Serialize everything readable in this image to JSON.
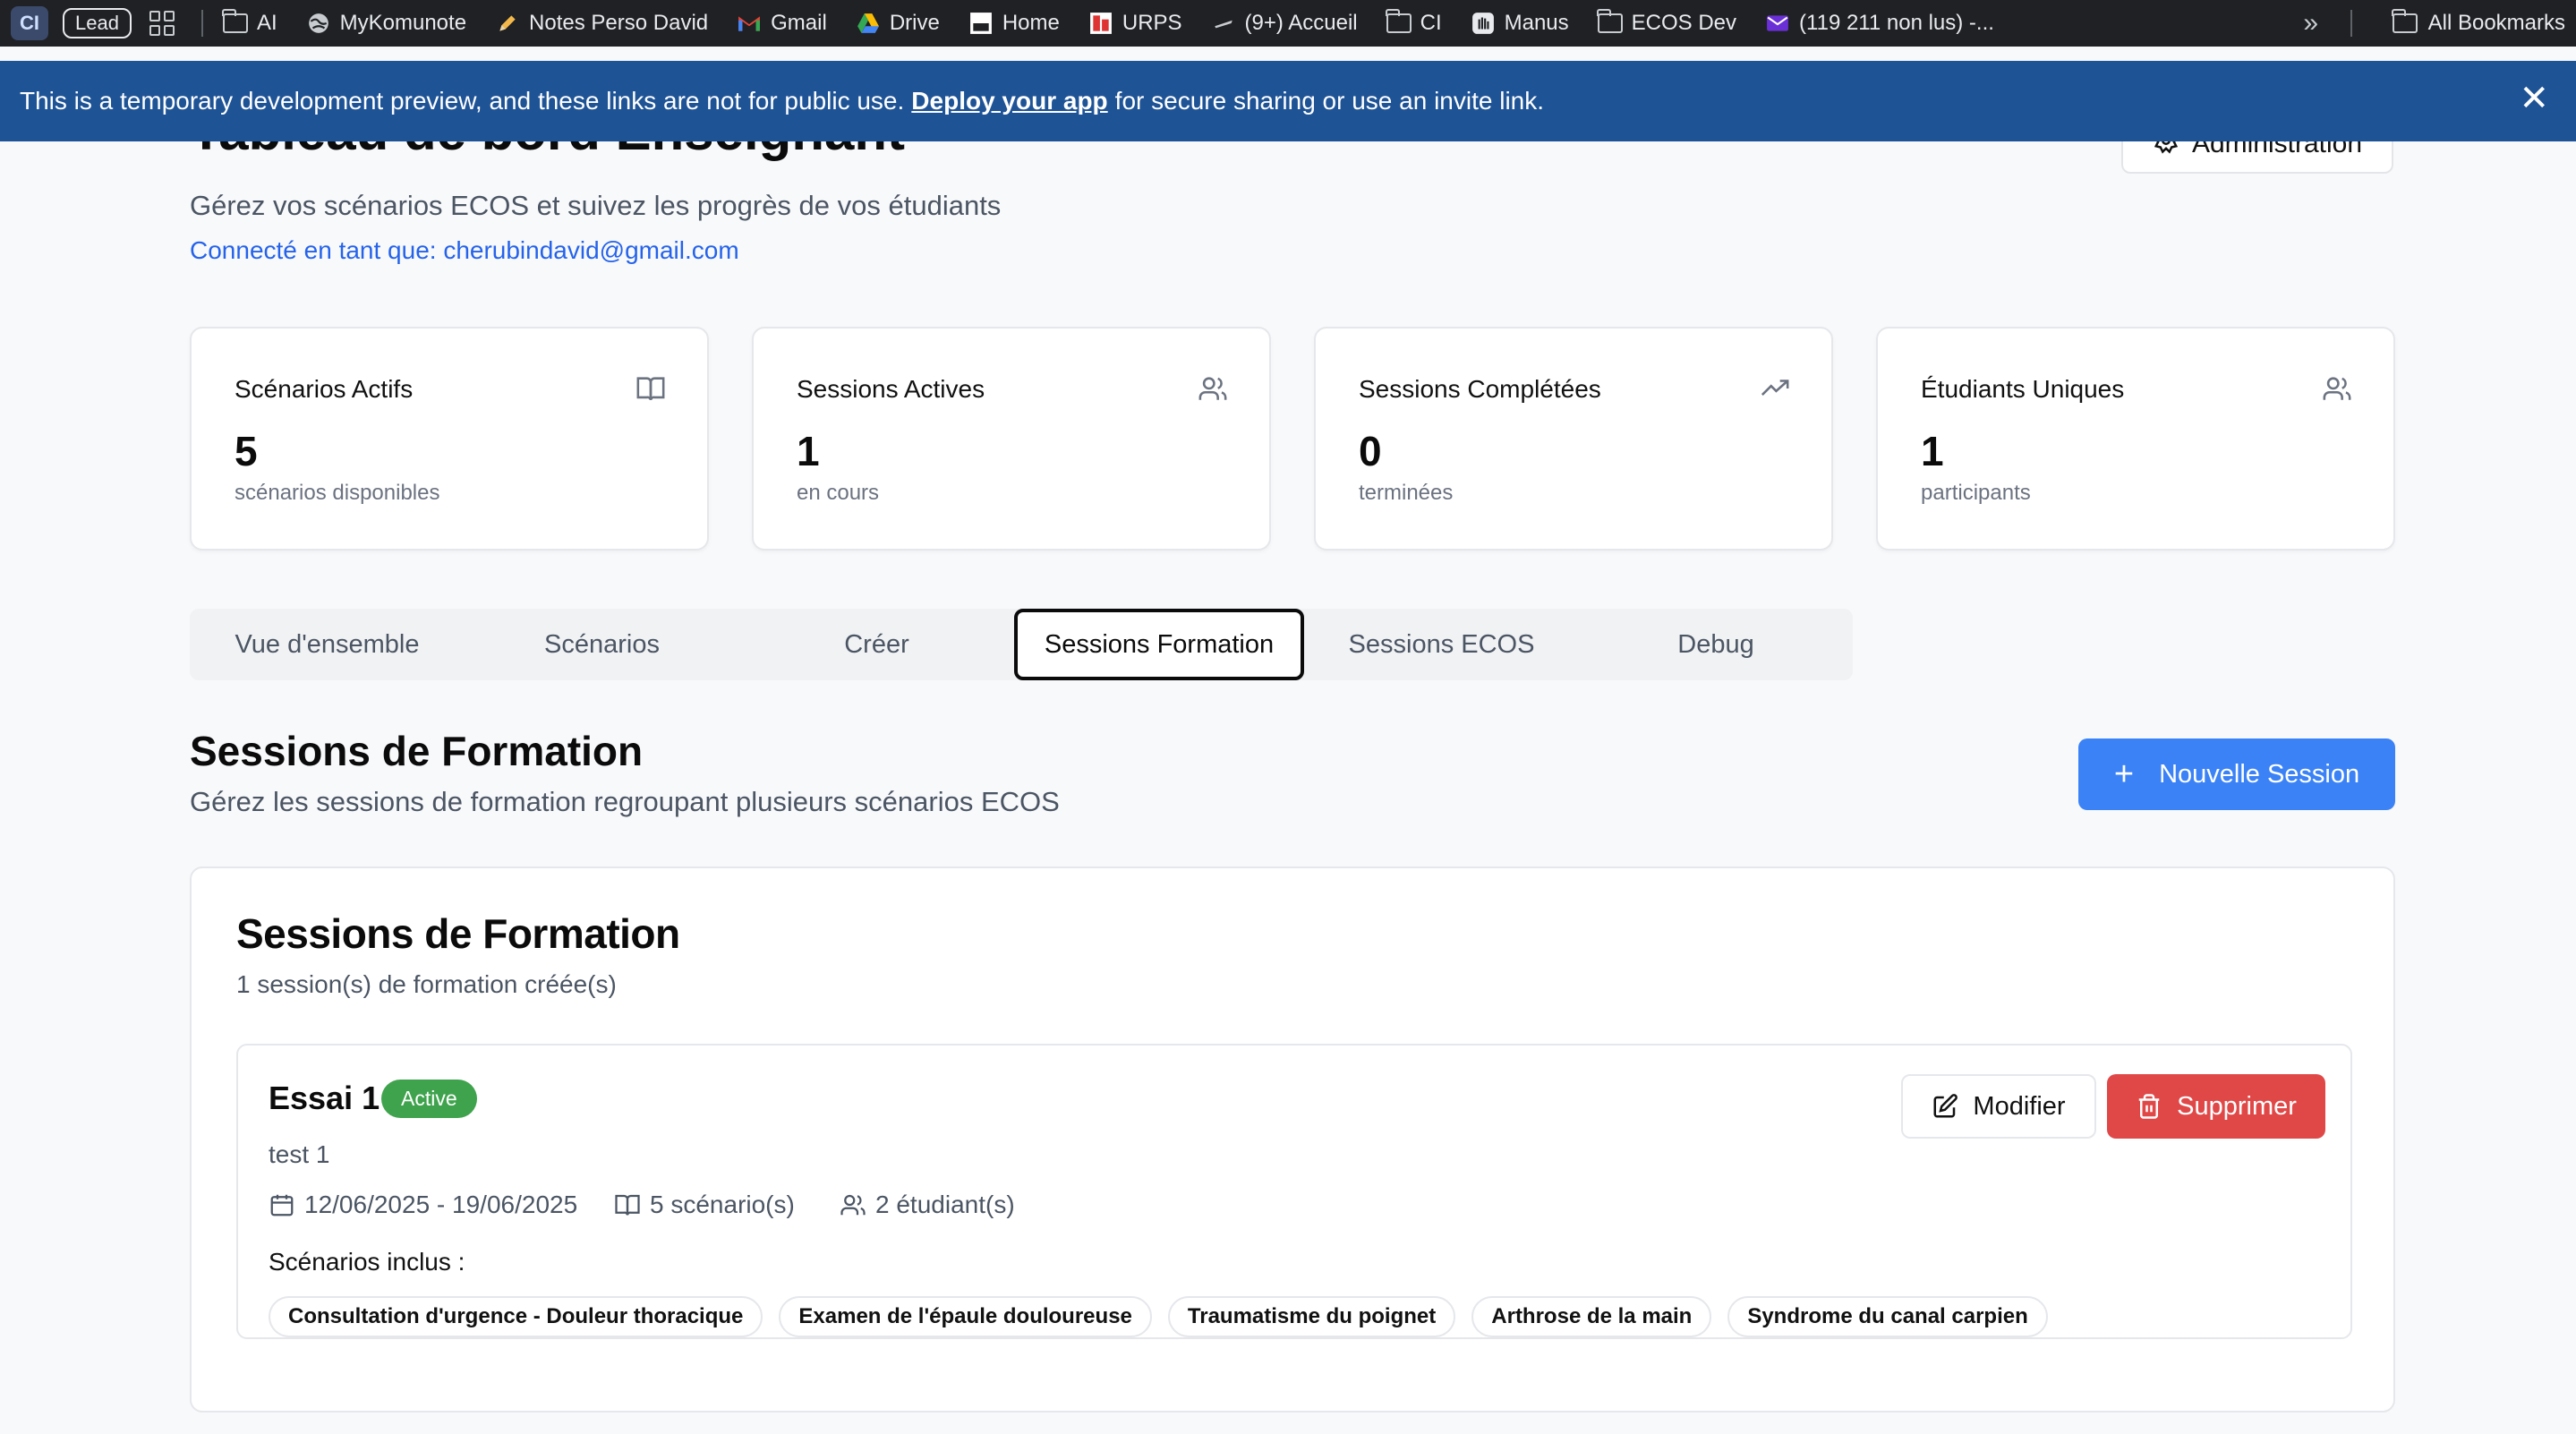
{
  "bookmarks_bar": {
    "profile_badge": "CI",
    "lead_label": "Lead",
    "items": [
      {
        "label": "AI",
        "icon": "folder-icon"
      },
      {
        "label": "MyKomunote",
        "icon": "globe-icon"
      },
      {
        "label": "Notes Perso David",
        "icon": "pencil-icon"
      },
      {
        "label": "Gmail",
        "icon": "gmail-icon"
      },
      {
        "label": "Drive",
        "icon": "drive-icon"
      },
      {
        "label": "Home",
        "icon": "home-favicon"
      },
      {
        "label": "URPS",
        "icon": "urps-favicon"
      },
      {
        "label": "(9+) Accueil",
        "icon": "accueil-favicon"
      },
      {
        "label": "CI",
        "icon": "folder-icon"
      },
      {
        "label": "Manus",
        "icon": "manus-icon"
      },
      {
        "label": "ECOS Dev",
        "icon": "folder-icon"
      },
      {
        "label": "(119 211 non lus) -...",
        "icon": "mail-favicon"
      }
    ],
    "overflow_label": "»",
    "all_bookmarks_label": "All Bookmarks"
  },
  "banner": {
    "text_before": "This is a temporary development preview, and these links are not for public use.",
    "link_label": "Deploy your app",
    "text_after": "for secure sharing or use an invite link.",
    "close_label": "✕",
    "color": "#1e5396"
  },
  "header": {
    "title": "Tableau de bord Enseignant",
    "admin_button_label": "Administration",
    "subtitle": "Gérez vos scénarios ECOS et suivez les progrès de vos étudiants",
    "connected_as": "Connecté en tant que: cherubindavid@gmail.com"
  },
  "stats": [
    {
      "label": "Scénarios Actifs",
      "value": "5",
      "sub": "scénarios disponibles",
      "icon": "book-icon"
    },
    {
      "label": "Sessions Actives",
      "value": "1",
      "sub": "en cours",
      "icon": "users-icon"
    },
    {
      "label": "Sessions Complétées",
      "value": "0",
      "sub": "terminées",
      "icon": "trending-up-icon"
    },
    {
      "label": "Étudiants Uniques",
      "value": "1",
      "sub": "participants",
      "icon": "users-icon"
    }
  ],
  "tabs": [
    {
      "label": "Vue d'ensemble",
      "active": false
    },
    {
      "label": "Scénarios",
      "active": false
    },
    {
      "label": "Créer",
      "active": false
    },
    {
      "label": "Sessions Formation",
      "active": true
    },
    {
      "label": "Sessions ECOS",
      "active": false
    },
    {
      "label": "Debug",
      "active": false
    }
  ],
  "section": {
    "title": "Sessions de Formation",
    "subtitle": "Gérez les sessions de formation regroupant plusieurs scénarios ECOS",
    "new_button_label": "Nouvelle Session",
    "new_button_color": "#3b82f6"
  },
  "card": {
    "title": "Sessions de Formation",
    "subtitle": "1 session(s) de formation créée(s)",
    "session": {
      "name": "Essai 1",
      "status": "Active",
      "status_color": "#3fa34d",
      "description": "test 1",
      "dates": "12/06/2025 - 19/06/2025",
      "scenario_count": "5 scénario(s)",
      "student_count": "2 étudiant(s)",
      "included_label": "Scénarios inclus :",
      "scenarios": [
        "Consultation d'urgence - Douleur thoracique",
        "Examen de l'épaule douloureuse",
        "Traumatisme du poignet",
        "Arthrose de la main",
        "Syndrome du canal carpien"
      ],
      "edit_label": "Modifier",
      "delete_label": "Supprimer",
      "delete_color": "#e04848"
    }
  }
}
